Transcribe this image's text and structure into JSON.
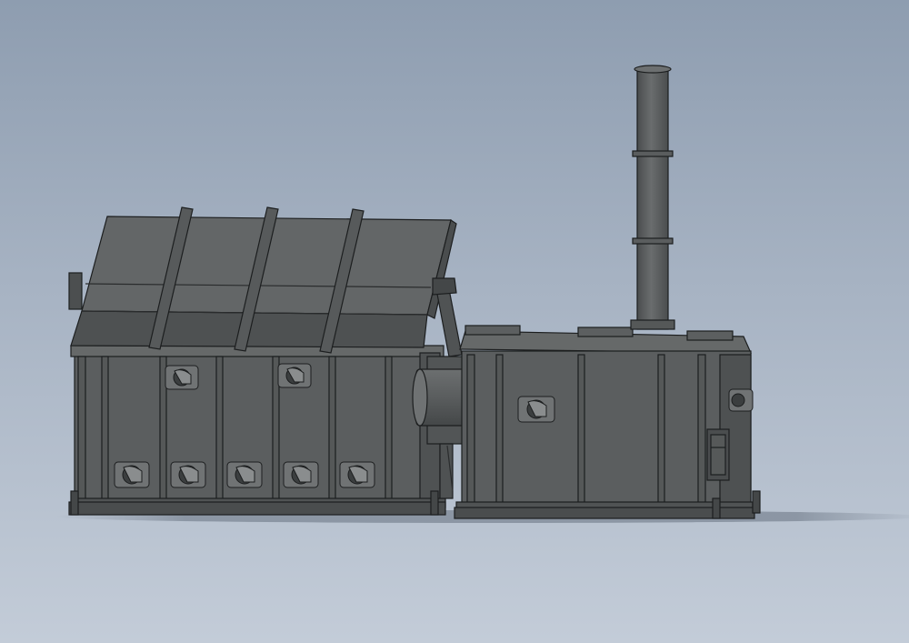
{
  "viewport": {
    "background_top": "#8e9db0",
    "background_bottom": "#c3ccd8"
  },
  "model": {
    "body_color": "#5b5e5f",
    "body_shade": "#4e5152",
    "edge_color": "#1c1e1f",
    "highlight_color": "#6e7172",
    "components": [
      "primary-chamber",
      "hinged-lid",
      "secondary-chamber",
      "exhaust-stack",
      "transfer-duct",
      "burner-ports",
      "access-door",
      "skid-base"
    ]
  }
}
